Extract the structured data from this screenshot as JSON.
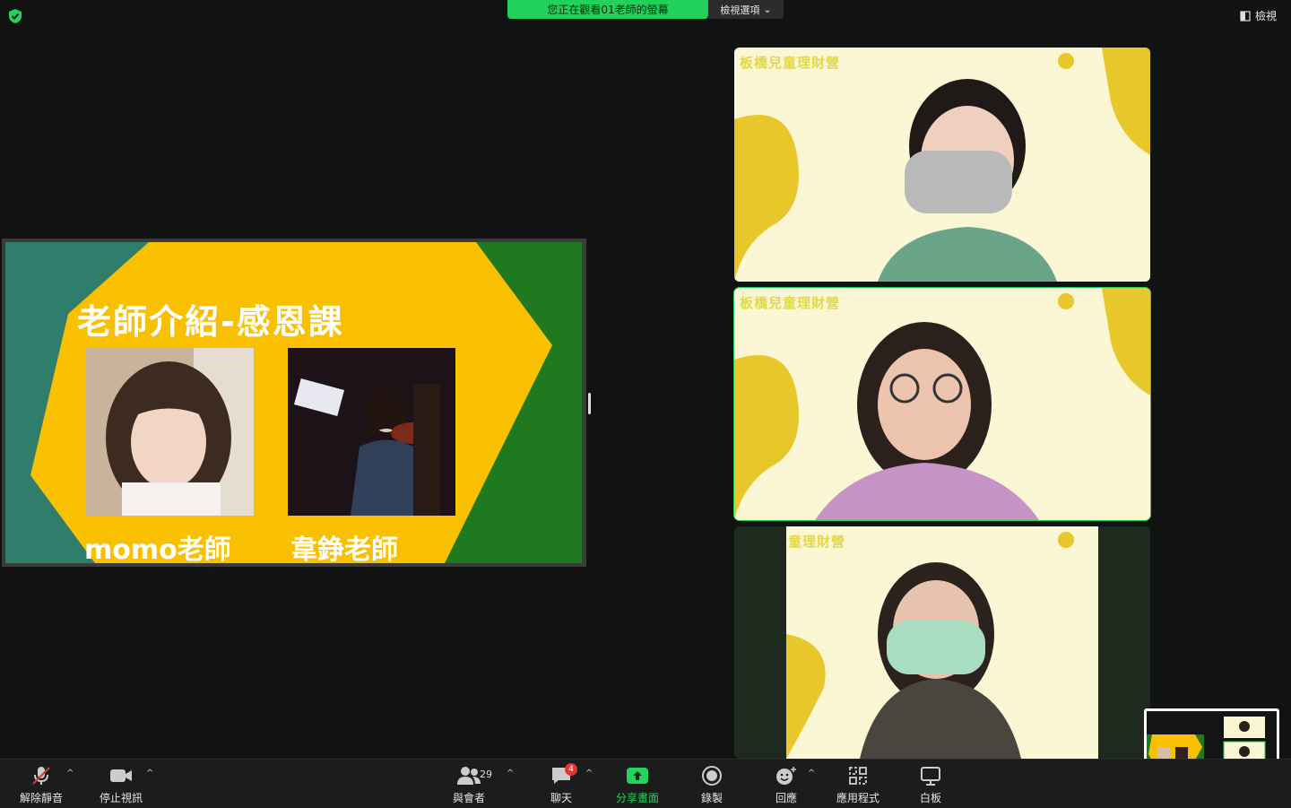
{
  "top": {
    "banner": "您正在觀看01老師的螢幕",
    "view_options": "檢視選項",
    "view_button": "檢視"
  },
  "slide": {
    "title": "老師介紹-感恩課",
    "teachers": [
      {
        "name": "momo老師"
      },
      {
        "name": "韋錚老師"
      }
    ]
  },
  "tiles": [
    {
      "background_text": "板橋兒童理財營"
    },
    {
      "background_text": "板橋兒童理財營"
    },
    {
      "background_text": "童理財營"
    }
  ],
  "toolbar": {
    "unmute": "解除靜音",
    "stop_video": "停止視訊",
    "participants": "與會者",
    "participants_count": "29",
    "chat": "聊天",
    "chat_badge": "4",
    "share_screen": "分享畫面",
    "record": "錄製",
    "reactions": "回應",
    "apps": "應用程式",
    "whiteboard": "白板"
  },
  "colors": {
    "accent_green": "#21d15a",
    "slide_yellow": "#f9c000",
    "slide_green": "#1f7a1f",
    "slide_teal": "#2f7d6b",
    "badge_red": "#e23434"
  }
}
